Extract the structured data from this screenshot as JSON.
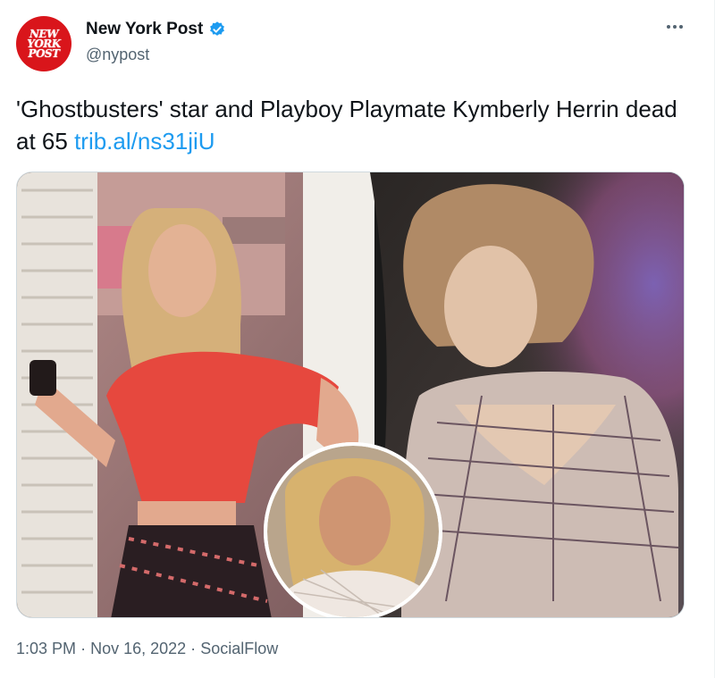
{
  "account": {
    "avatar_lines": [
      "NEW",
      "YORK",
      "POST"
    ],
    "display_name": "New York Post",
    "handle": "@nypost"
  },
  "tweet": {
    "text": "'Ghostbusters' star and Playboy Playmate Kymberly Herrin dead at 65",
    "link": "trib.al/ns31jiU"
  },
  "meta": {
    "time": "1:03 PM",
    "separator": "·",
    "date": "Nov 16, 2022",
    "source": "SocialFlow"
  },
  "colors": {
    "brand": "#d9151b",
    "link": "#1d9bf0",
    "verified": "#1d9bf0"
  }
}
